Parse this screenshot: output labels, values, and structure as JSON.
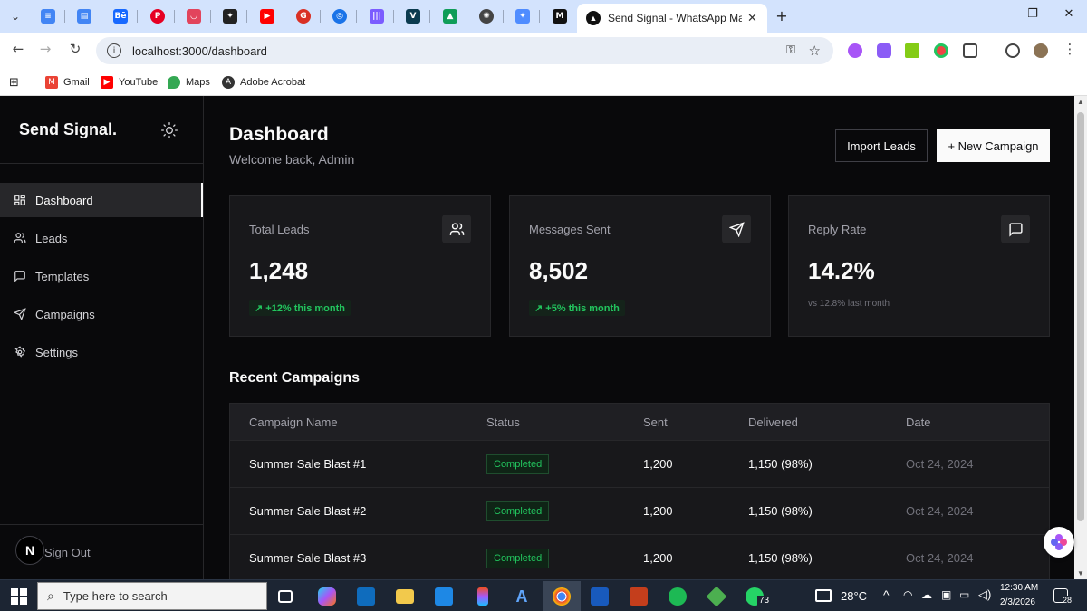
{
  "browser": {
    "active_tab_title": "Send Signal - WhatsApp Marke",
    "tab_close": "✕",
    "new_tab": "+",
    "url": "localhost:3000/dashboard",
    "bookmarks": [
      {
        "label": "Gmail",
        "icon": "gmail-icon"
      },
      {
        "label": "YouTube",
        "icon": "youtube-icon"
      },
      {
        "label": "Maps",
        "icon": "maps-icon"
      },
      {
        "label": "Adobe Acrobat",
        "icon": "acrobat-icon"
      }
    ]
  },
  "sidebar": {
    "brand": "Send Signal.",
    "items": [
      {
        "label": "Dashboard",
        "icon": "dashboard-icon",
        "active": true
      },
      {
        "label": "Leads",
        "icon": "users-icon"
      },
      {
        "label": "Templates",
        "icon": "message-icon"
      },
      {
        "label": "Campaigns",
        "icon": "send-icon"
      },
      {
        "label": "Settings",
        "icon": "gear-icon"
      }
    ],
    "avatar_letter": "N",
    "sign_out": "Sign Out"
  },
  "header": {
    "title": "Dashboard",
    "welcome": "Welcome back, Admin",
    "import_button": "Import Leads",
    "new_button": "+ New Campaign"
  },
  "stats": [
    {
      "label": "Total Leads",
      "value": "1,248",
      "badge": "↗ +12% this month",
      "icon": "users-icon"
    },
    {
      "label": "Messages Sent",
      "value": "8,502",
      "badge": "↗ +5% this month",
      "icon": "send-icon"
    },
    {
      "label": "Reply Rate",
      "value": "14.2%",
      "sub": "vs 12.8% last month",
      "icon": "message-icon"
    }
  ],
  "campaigns": {
    "title": "Recent Campaigns",
    "headers": [
      "Campaign Name",
      "Status",
      "Sent",
      "Delivered",
      "Date"
    ],
    "rows": [
      {
        "name": "Summer Sale Blast #1",
        "status": "Completed",
        "sent": "1,200",
        "delivered": "1,150 (98%)",
        "date": "Oct 24, 2024"
      },
      {
        "name": "Summer Sale Blast #2",
        "status": "Completed",
        "sent": "1,200",
        "delivered": "1,150 (98%)",
        "date": "Oct 24, 2024"
      },
      {
        "name": "Summer Sale Blast #3",
        "status": "Completed",
        "sent": "1,200",
        "delivered": "1,150 (98%)",
        "date": "Oct 24, 2024"
      }
    ]
  },
  "taskbar": {
    "search_placeholder": "Type here to search",
    "whatsapp_count": "73",
    "weather": "28°C",
    "time": "12:30 AM",
    "date": "2/3/2026",
    "notifications": "28"
  },
  "colors": {
    "accent_green": "#22c55e",
    "background": "#09090b"
  }
}
